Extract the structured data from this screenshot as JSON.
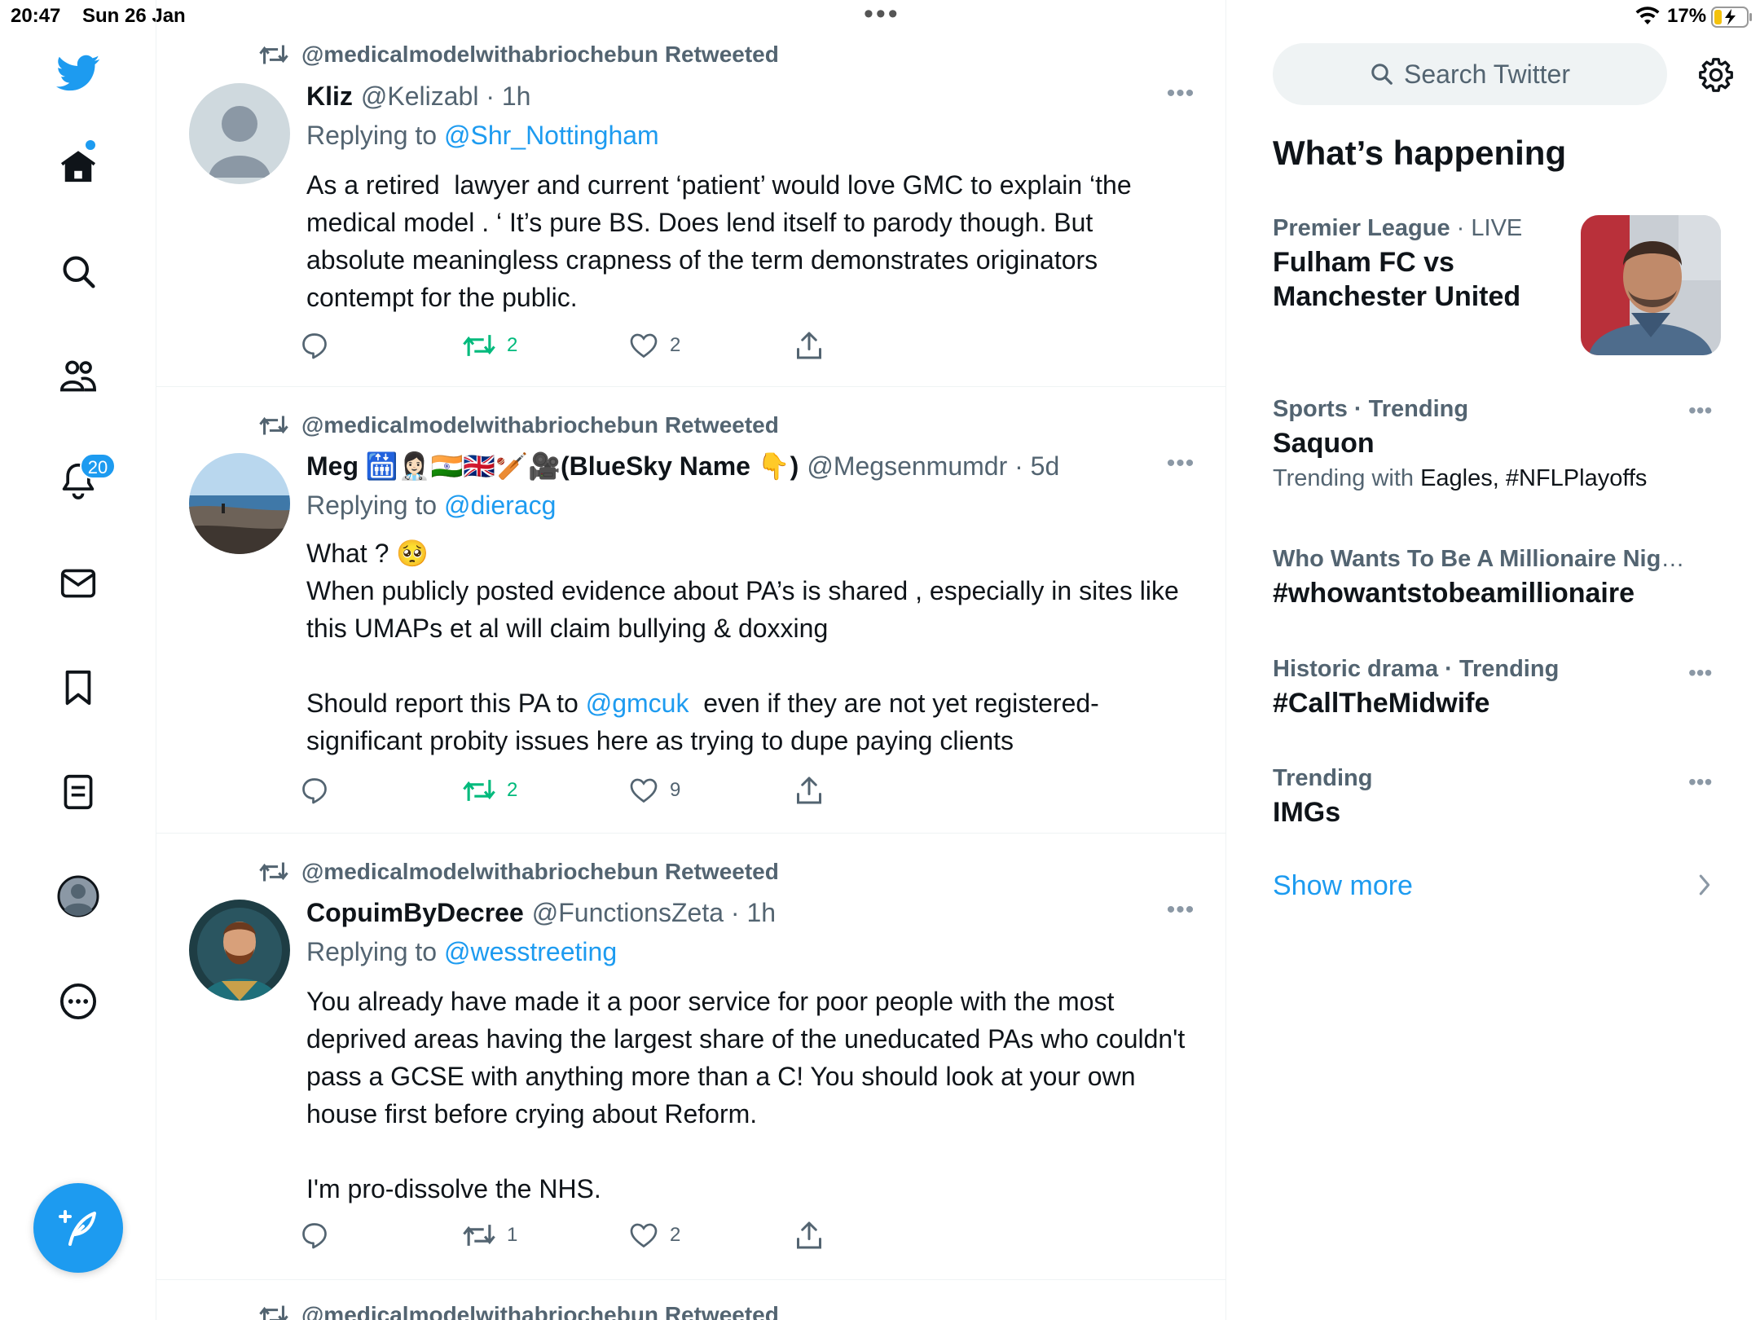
{
  "status_bar": {
    "time": "20:47",
    "date": "Sun 26 Jan",
    "battery": "17%"
  },
  "nav": {
    "items": [
      "twitter-logo",
      "home",
      "explore",
      "communities",
      "notifications",
      "messages",
      "bookmarks",
      "lists",
      "profile",
      "more"
    ],
    "notifications_badge": "20"
  },
  "tweets": [
    {
      "retweeted_by": "@medicalmodelwithabriochebun Retweeted",
      "name": "Kliz",
      "handle_time": "@Kelizabl · 1h",
      "replying_label": "Replying to",
      "replying_to": "@Shr_Nottingham",
      "text": "As a retired  lawyer and current ‘patient’ would love GMC to explain ‘the medical model . ‘ It’s pure BS. Does lend itself to parody though. But absolute meaningless crapness of the term demonstrates originators contempt for the public.",
      "replies": "",
      "retweets": "2",
      "likes": "2"
    },
    {
      "retweeted_by": "@medicalmodelwithabriochebun Retweeted",
      "name": "Meg 🛗👩🏻‍⚕️🇮🇳🇬🇧🏏🎥(BlueSky Name 👇)",
      "handle_time": "@Megsenmumdr · 5d",
      "replying_label": "Replying to",
      "replying_to": "@dieracg",
      "text_line1": "What ? 🥺",
      "text_line2": "When publicly posted evidence about PA’s is shared , especially in sites like this UMAPs et al will claim bullying & doxxing",
      "text_line3_pre": "Should report this PA to ",
      "text_line3_mention": "@gmcuk",
      "text_line3_post": "  even if they are not yet registered- significant probity issues here as trying to dupe paying clients",
      "replies": "",
      "retweets": "2",
      "likes": "9"
    },
    {
      "retweeted_by": "@medicalmodelwithabriochebun Retweeted",
      "name": "CopuimByDecree",
      "handle_time": "@FunctionsZeta · 1h",
      "replying_label": "Replying to",
      "replying_to": "@wesstreeting",
      "text_line1": "You already have made it a poor service for poor people with the most deprived areas having the largest share of the uneducated PAs who couldn't pass a GCSE with anything more than a C! You should look at your own house first before crying about Reform.",
      "text_line2": "I'm pro-dissolve the NHS.",
      "replies": "",
      "retweets": "1",
      "likes": "2"
    },
    {
      "retweeted_by": "@medicalmodelwithabriochebun Retweeted"
    }
  ],
  "sidebar": {
    "search_placeholder": "Search Twitter",
    "whats_happening": "What’s happening",
    "trends": [
      {
        "category": "Premier League",
        "context": "LIVE",
        "topic_line1": "Fulham FC vs",
        "topic_line2": "Manchester United"
      },
      {
        "category": "Sports · Trending",
        "topic": "Saquon",
        "sub_prefix": "Trending with ",
        "sub_terms": "Eagles, #NFLPlayoffs"
      },
      {
        "category": "Who Wants To Be A Millionaire Nigeri...",
        "topic": "#whowantstobeamillionaire"
      },
      {
        "category": "Historic drama · Trending",
        "topic": "#CallTheMidwife"
      },
      {
        "category": "Trending",
        "topic": "IMGs"
      }
    ],
    "show_more": "Show more"
  },
  "colors": {
    "accent": "#1d9bf0",
    "retweet_green": "#00ba7c",
    "muted": "#536471",
    "text": "#0f1419"
  }
}
